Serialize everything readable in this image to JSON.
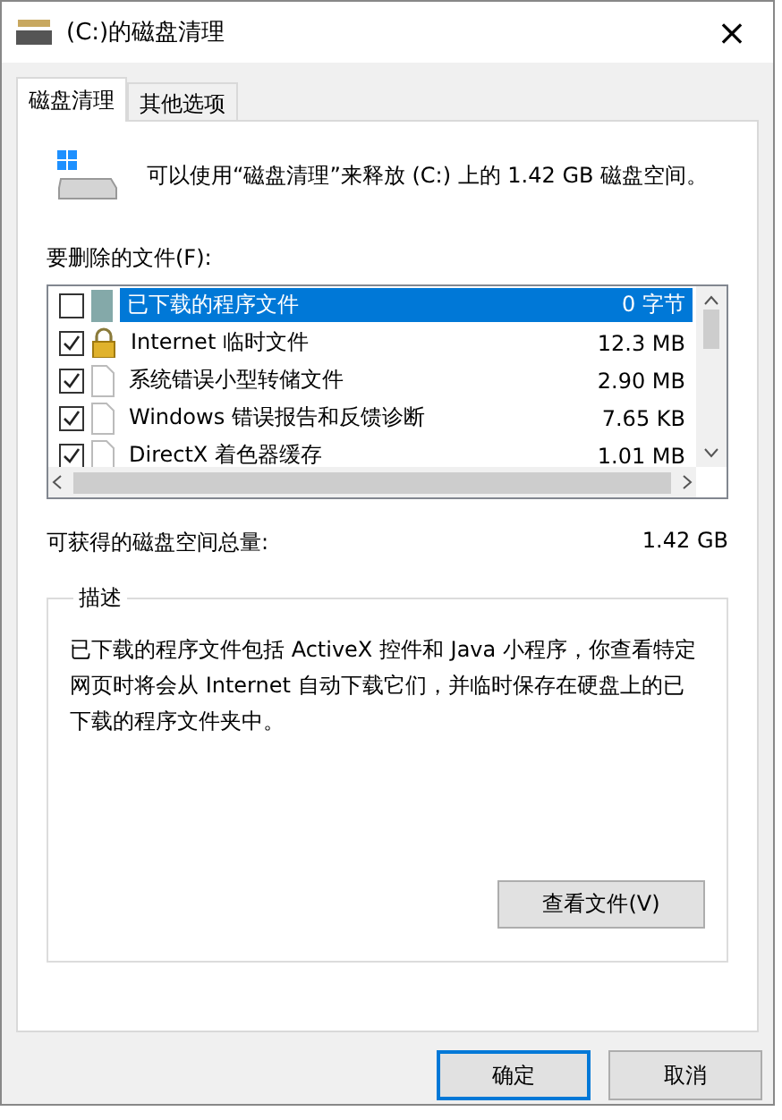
{
  "window": {
    "title": "(C:)的磁盘清理",
    "close": "×"
  },
  "tabs": [
    {
      "label": "磁盘清理",
      "selected": true
    },
    {
      "label": "其他选项",
      "selected": false
    }
  ],
  "header": {
    "text": "可以使用“磁盘清理”来释放 (C:) 上的 1.42 GB 磁盘空间。"
  },
  "files_label": "要删除的文件(F):",
  "files": [
    {
      "name": "已下载的程序文件",
      "size": "0 字节",
      "checked": false,
      "selected": true,
      "kind": "program"
    },
    {
      "name": "Internet 临时文件",
      "size": "12.3 MB",
      "checked": true,
      "selected": false,
      "kind": "locked"
    },
    {
      "name": "系统错误小型转储文件",
      "size": "2.90 MB",
      "checked": true,
      "selected": false,
      "kind": "file"
    },
    {
      "name": "Windows 错误报告和反馈诊断",
      "size": "7.65 KB",
      "checked": true,
      "selected": false,
      "kind": "file"
    },
    {
      "name": "DirectX 着色器缓存",
      "size": "1.01 MB",
      "checked": true,
      "selected": false,
      "kind": "file"
    }
  ],
  "total": {
    "label": "可获得的磁盘空间总量:",
    "value": "1.42 GB"
  },
  "description": {
    "title": "描述",
    "text": "已下载的程序文件包括 ActiveX 控件和 Java 小程序，你查看特定网页时将会从 Internet 自动下载它们，并临时保存在硬盘上的已下载的程序文件夹中。",
    "button": "查看文件(V)"
  },
  "buttons": [
    {
      "label": "确定",
      "focused": true
    },
    {
      "label": "取消",
      "focused": false
    }
  ]
}
